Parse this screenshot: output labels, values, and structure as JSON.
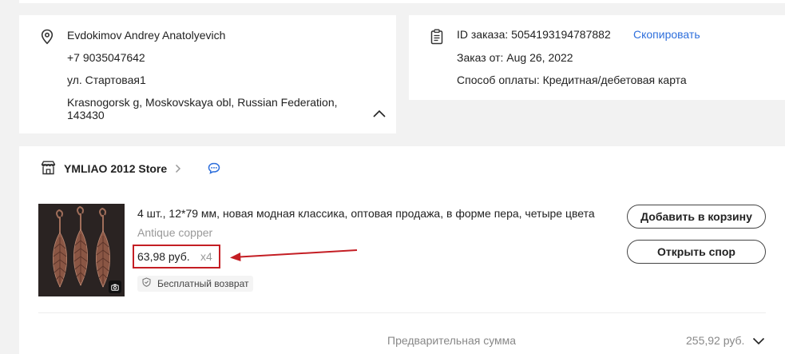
{
  "address": {
    "name": "Evdokimov Andrey Anatolyevich",
    "phone": "+7 9035047642",
    "street": "ул. Стартовая1",
    "city_line1": "Krasnogorsk g, Moskovskaya obl, Russian Federation,",
    "city_line2": "143430",
    "icons": {
      "location": "location-pin-icon",
      "collapse": "chevron-up-icon"
    }
  },
  "order": {
    "id_label": "ID заказа:",
    "id_value": "5054193194787882",
    "copy_label": "Скопировать",
    "date_label": "Заказ от:",
    "date_value": "Aug 26, 2022",
    "payment_label": "Способ оплаты:",
    "payment_value": "Кредитная/дебетовая карта",
    "icon": "document-icon"
  },
  "store": {
    "name": "YMLIAO 2012 Store",
    "icons": {
      "store": "store-icon",
      "chevron": "chevron-right-icon",
      "chat": "chat-icon"
    }
  },
  "item": {
    "title": "4 шт., 12*79 мм, новая модная классика, оптовая продажа, в форме пера, четыре цвета",
    "variant": "Antique copper",
    "price": "63,98 руб.",
    "quantity": "x4",
    "return_badge": "Бесплатный возврат",
    "add_to_cart": "Добавить в корзину",
    "open_dispute": "Открыть спор",
    "icons": {
      "camera": "camera-icon",
      "shield": "shield-check-icon",
      "annotation": "red-arrow-icon"
    }
  },
  "summary": {
    "subtotal_label": "Предварительная сумма",
    "subtotal_value": "255,92 руб."
  },
  "colors": {
    "link": "#2e6fdc",
    "highlight": "#c41e24",
    "chat": "#2e6fdc"
  }
}
